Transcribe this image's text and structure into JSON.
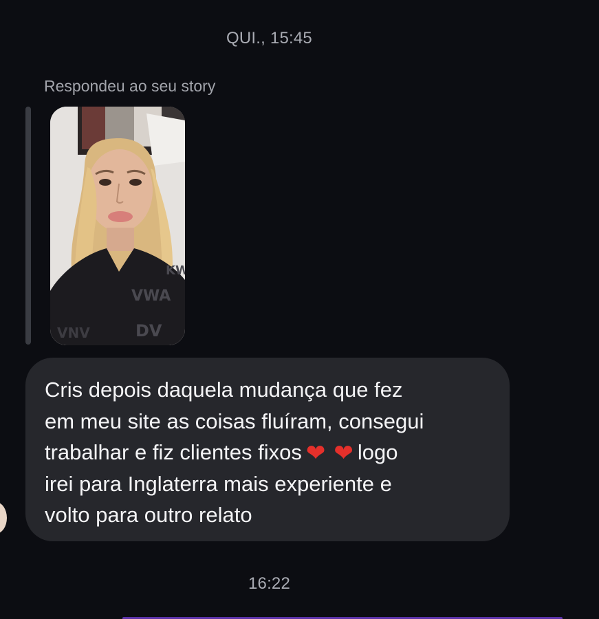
{
  "conversation": {
    "first_timestamp": "QUI., 15:45",
    "reply_label": "Respondeu ao seu story",
    "story_thumbnail_icon": "story-photo-thumbnail",
    "message": {
      "line1": "Cris depois daquela mudança que fez",
      "line2": "em meu site as coisas fluíram, consegui",
      "line3_before_hearts": "trabalhar e fiz clientes fixos",
      "heart1": "❤",
      "heart2": "❤",
      "line3_after_hearts": "logo",
      "line4": "irei para Inglaterra mais experiente e",
      "line5": "volto para outro relato"
    },
    "second_timestamp": "16:22"
  },
  "colors": {
    "background": "#0c0d12",
    "bubble": "#26272c",
    "text": "#f4f4f6",
    "muted_text": "#a9abb3",
    "heart": "#e5302b",
    "accent": "#5b32a8"
  }
}
